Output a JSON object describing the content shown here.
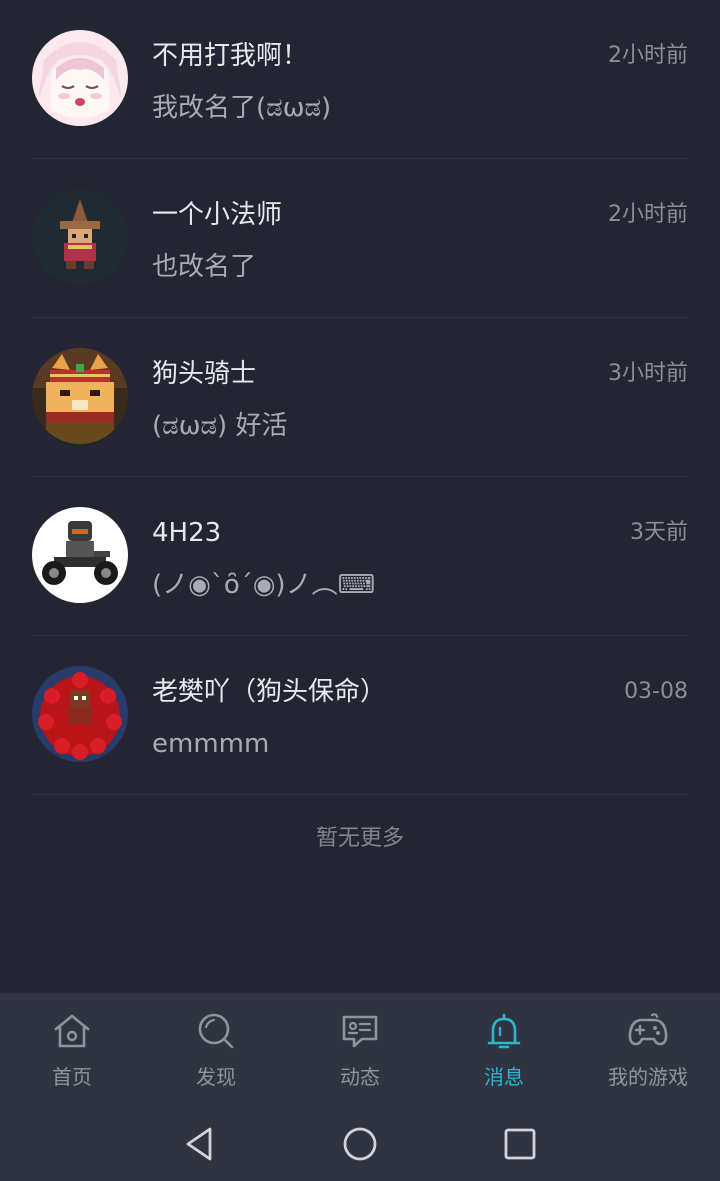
{
  "conversations": [
    {
      "name": "不用打我啊！",
      "preview": "我改名了(ಡωಡ)",
      "time": "2小时前"
    },
    {
      "name": "一个小法师",
      "preview": "也改名了",
      "time": "2小时前"
    },
    {
      "name": "狗头骑士",
      "preview": "(ಡωಡ) 好活",
      "time": "3小时前"
    },
    {
      "name": "4H23",
      "preview": "(ノ◉`ȏ´◉)ノ︵⌨",
      "time": "3天前"
    },
    {
      "name": "老樊吖（狗头保命）",
      "preview": "emmmm",
      "time": "03-08"
    }
  ],
  "list_footer": "暂无更多",
  "tabs": [
    {
      "label": "首页",
      "icon": "home-icon"
    },
    {
      "label": "发现",
      "icon": "search-icon"
    },
    {
      "label": "动态",
      "icon": "feed-icon"
    },
    {
      "label": "消息",
      "icon": "bell-icon",
      "active": true
    },
    {
      "label": "我的游戏",
      "icon": "gamepad-icon"
    }
  ],
  "colors": {
    "background": "#232632",
    "tabbar": "#303441",
    "accent": "#2ab7cf"
  }
}
